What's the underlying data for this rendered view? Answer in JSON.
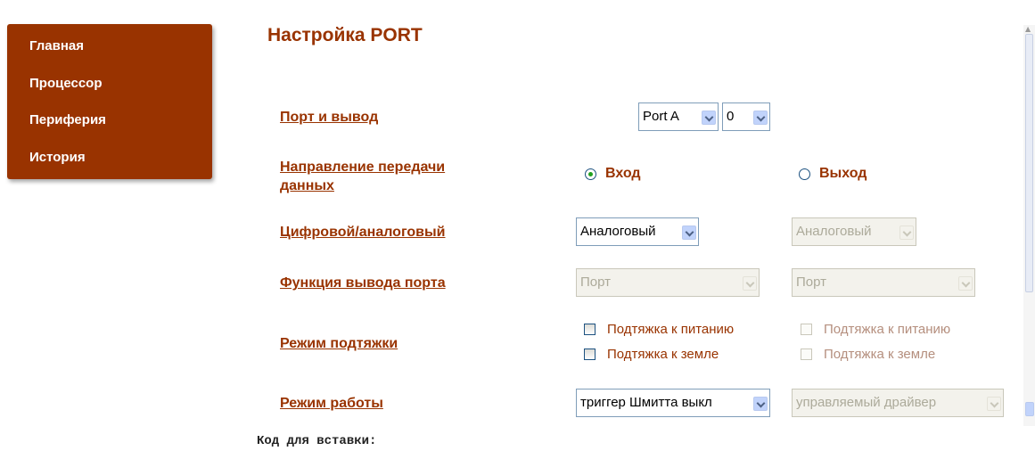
{
  "nav": {
    "items": [
      "Главная",
      "Процессор",
      "Периферия",
      "История"
    ]
  },
  "page": {
    "title": "Настройка PORT",
    "code_label": "Код для вставки:"
  },
  "rows": {
    "port_output": {
      "label": "Порт и вывод",
      "port_value": "Port A",
      "pin_value": "0"
    },
    "direction": {
      "label_line1": "Направление передачи",
      "label_line2": "данных",
      "input_label": "Вход",
      "output_label": "Выход",
      "selected": "Вход"
    },
    "digital_analog": {
      "label": "Цифровой/аналоговый",
      "value_a": "Аналоговый",
      "value_b": "Аналоговый"
    },
    "port_function": {
      "label": "Функция вывода порта",
      "value_a": "Порт",
      "value_b": "Порт"
    },
    "pull_mode": {
      "label": "Режим подтяжки",
      "pull_up": "Подтяжка к питанию",
      "pull_down": "Подтяжка к земле",
      "pull_up_b": "Подтяжка к питанию",
      "pull_down_b": "Подтяжка к земле"
    },
    "work_mode": {
      "label": "Режим работы",
      "value_a": "триггер Шмитта выкл",
      "value_b": "управляемый драйвер"
    }
  },
  "colors": {
    "accent": "#993300",
    "nav_bg": "#993300"
  }
}
